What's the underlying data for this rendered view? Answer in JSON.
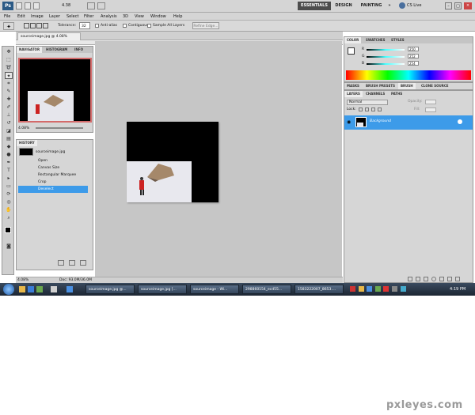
{
  "app": {
    "logo": "Ps",
    "zoom_menu": "4.38",
    "cs_live": "CS Live"
  },
  "workspaces": {
    "essentials": "ESSENTIALS",
    "design": "DESIGN",
    "painting": "PAINTING"
  },
  "menu": [
    "File",
    "Edit",
    "Image",
    "Layer",
    "Select",
    "Filter",
    "Analysis",
    "3D",
    "View",
    "Window",
    "Help"
  ],
  "options": {
    "tolerance_label": "Tolerance:",
    "tolerance_value": "32",
    "antialias": "Anti-alias",
    "contiguous": "Contiguous",
    "sample_all": "Sample All Layers",
    "refine_edge": "Refine Edge..."
  },
  "document": {
    "tab": "sourceimage.jpg @ 4.08% (RGB/8#)",
    "status_zoom": "4.08%",
    "status_doc": "Doc: 93.0M/36.0M"
  },
  "navigator": {
    "tabs": [
      "NAVIGATOR",
      "HISTOGRAM",
      "INFO"
    ],
    "zoom": "4.08%"
  },
  "history": {
    "title": "HISTORY",
    "snapshot": "sourceimage.jpg",
    "items": [
      "Open",
      "Canvas Size",
      "Rectangular Marquee",
      "Crop",
      "Deselect"
    ],
    "selected_index": 4
  },
  "color_panel": {
    "tabs": [
      "COLOR",
      "SWATCHES",
      "STYLES"
    ],
    "r": "250",
    "g": "252",
    "b": "254"
  },
  "masks_panel": {
    "tabs": [
      "MASKS",
      "BRUSH PRESETS",
      "BRUSH",
      "CLONE SOURCE"
    ]
  },
  "layers_panel": {
    "tabs": [
      "LAYERS",
      "CHANNELS",
      "PATHS"
    ],
    "blend": "Normal",
    "opacity_label": "Opacity:",
    "lock_label": "Lock:",
    "fill_label": "Fill:",
    "layer_name": "Background"
  },
  "taskbar": {
    "items": [
      "sourceimage.jpg @...",
      "sourceimage.jpg [...",
      "sourceimage - Wi...",
      "298860154_ecd55...",
      "1583222007_8653...."
    ],
    "clock": "4:19 PM"
  },
  "watermark": "pxleyes.com",
  "colors": {
    "selection_blue": "#3d9be9",
    "dark_bg": "#000000",
    "snow": "#e8e8ee"
  }
}
